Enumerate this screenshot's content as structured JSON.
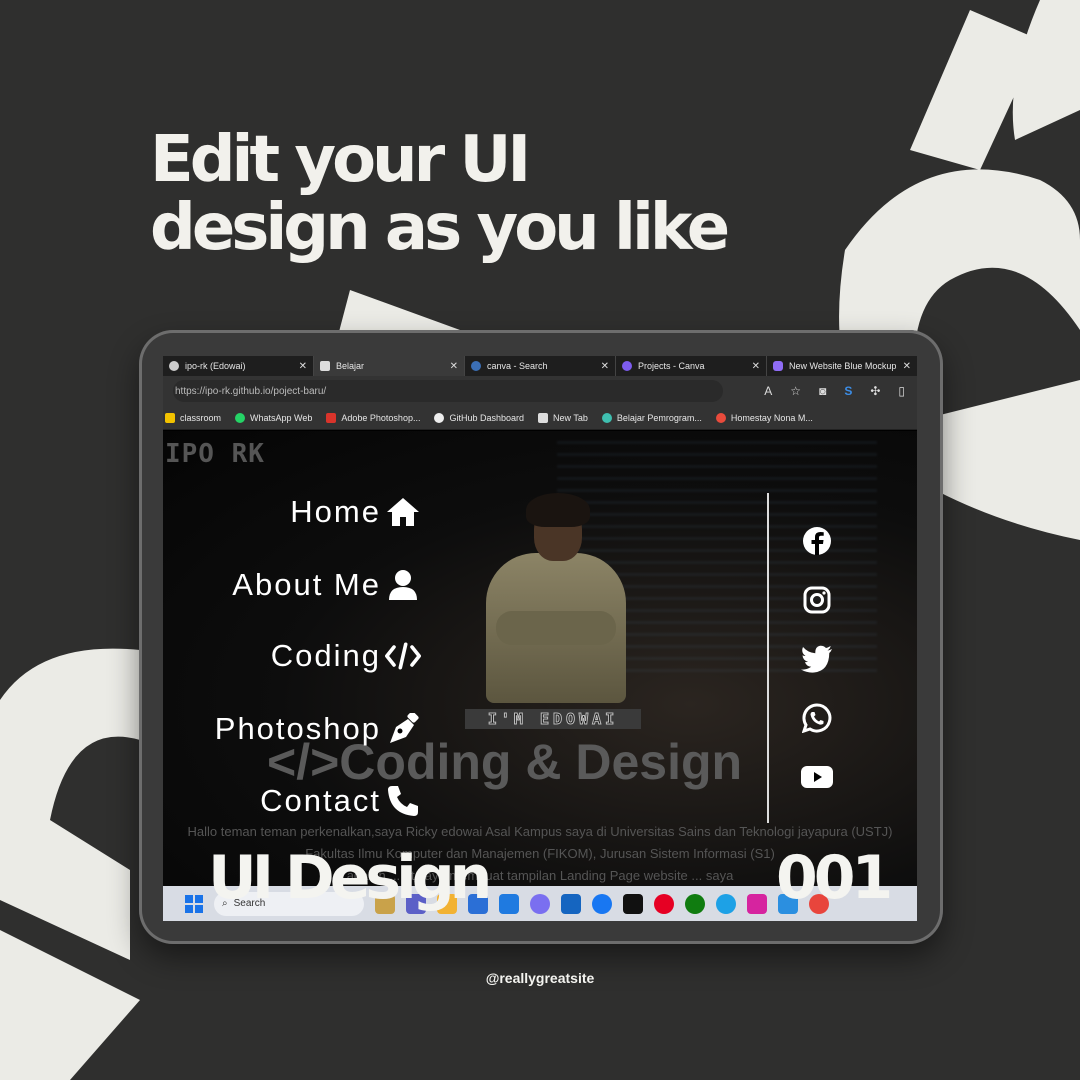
{
  "headline": {
    "line1": "Edit your UI",
    "line2": "design as you like"
  },
  "browser": {
    "tabs": [
      {
        "label": "ipo-rk (Edowai)",
        "active": false
      },
      {
        "label": "Belajar",
        "active": true
      },
      {
        "label": "canva - Search",
        "active": false
      },
      {
        "label": "Projects - Canva",
        "active": false
      },
      {
        "label": "New Website Blue Mockup",
        "active": false
      }
    ],
    "url": "https://ipo-rk.github.io/poject-baru/",
    "bookmarks": [
      "classroom",
      "WhatsApp Web",
      "Adobe Photoshop...",
      "GitHub Dashboard",
      "New Tab",
      "Belajar Pemrogram...",
      "Homestay Nona M..."
    ]
  },
  "site": {
    "logo": "IPO RK",
    "nav": [
      {
        "label": "Home",
        "icon": "home-icon"
      },
      {
        "label": "About Me",
        "icon": "user-icon"
      },
      {
        "label": "Coding",
        "icon": "code-icon"
      },
      {
        "label": "Photoshop",
        "icon": "pen-icon"
      },
      {
        "label": "Contact",
        "icon": "phone-icon"
      }
    ],
    "badge": "I'M EDOWAI",
    "hero_title": "Coding & Design",
    "social": [
      "facebook-icon",
      "instagram-icon",
      "twitter-icon",
      "whatsapp-icon",
      "youtube-icon"
    ],
    "intro_lines": [
      "Hallo teman teman perkenalkan,saya Ricky edowai Asal Kampus saya di Universitas Sains dan Teknologi jayapura (USTJ)",
      "Fakultas Ilmu Komputer dan Manajemen (FIKOM), Jurusan Sistem Informasi (S1)",
      "adalah ... et saya membuat tampilan Landing Page website ... saya"
    ]
  },
  "taskbar": {
    "search_placeholder": "Search"
  },
  "overlay": {
    "title": "UI Design",
    "number": "001"
  },
  "handle": "@reallygreatsite",
  "colors": {
    "background": "#2f2f2e",
    "accent": "#ebebe6"
  }
}
